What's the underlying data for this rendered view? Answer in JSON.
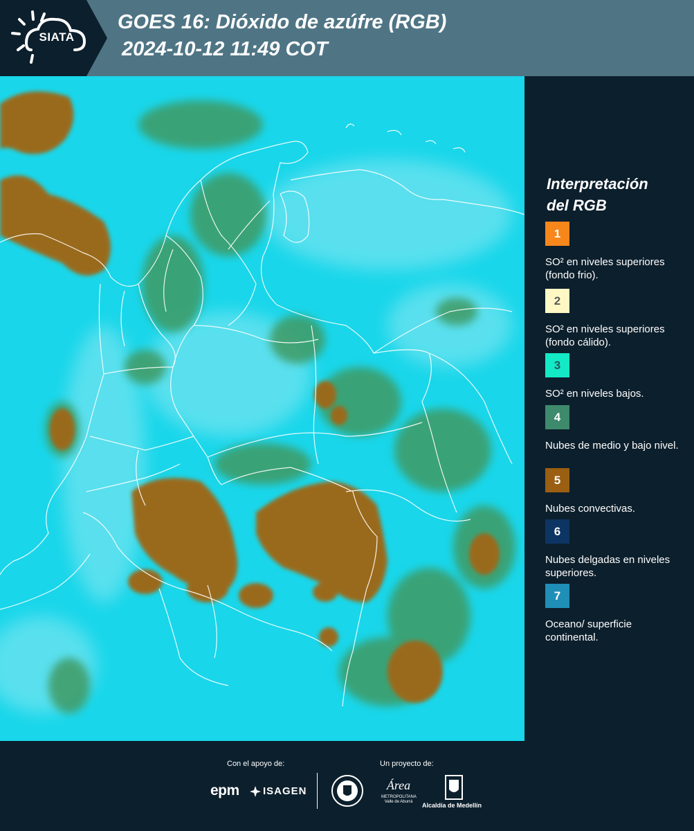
{
  "header": {
    "logo_text": "SIATA",
    "title_line1": "GOES 16: Dióxido de azúfre (RGB)",
    "title_line2": "2024-10-12 11:49 COT"
  },
  "legend": {
    "title_line1": "Interpretación",
    "title_line2": "del RGB",
    "items": [
      {
        "number": "1",
        "color": "#f7861b",
        "num_color": "#ffffff",
        "label": "SO² en niveles superiores (fondo frio)."
      },
      {
        "number": "2",
        "color": "#fff8c4",
        "num_color": "#5a5a5a",
        "label": "SO² en niveles superiores (fondo cálido)."
      },
      {
        "number": "3",
        "color": "#14e9c6",
        "num_color": "#1d5a5a",
        "label": "SO² en niveles bajos."
      },
      {
        "number": "4",
        "color": "#3d8a6c",
        "num_color": "#ffffff",
        "label": "Nubes de medio y bajo nivel."
      },
      {
        "number": "5",
        "color": "#9a5f12",
        "num_color": "#ffffff",
        "label": "Nubes convectivas."
      },
      {
        "number": "6",
        "color": "#0d3563",
        "num_color": "#ffffff",
        "label": "Nubes delgadas en niveles superiores."
      },
      {
        "number": "7",
        "color": "#1f8fb8",
        "num_color": "#ffffff",
        "label": "Oceano/ superficie continental."
      }
    ]
  },
  "footer": {
    "support_label": "Con el apoyo de:",
    "project_label": "Un proyecto de:",
    "sponsor_epm": "epm",
    "sponsor_isagen": "ISAGEN",
    "area_caption": "METROPOLITANA Valle de Aburrá",
    "area_logo_text": "Área",
    "alcaldia": "Alcaldía de Medellín"
  },
  "colors": {
    "header_bg": "#4f7585",
    "panel_bg": "#0c1f2c",
    "ocean_cyan": "#19d6ea",
    "convective_brown": "#9a6a1c",
    "low_cloud_green": "#3f9a63",
    "borders": "#ffffff"
  }
}
